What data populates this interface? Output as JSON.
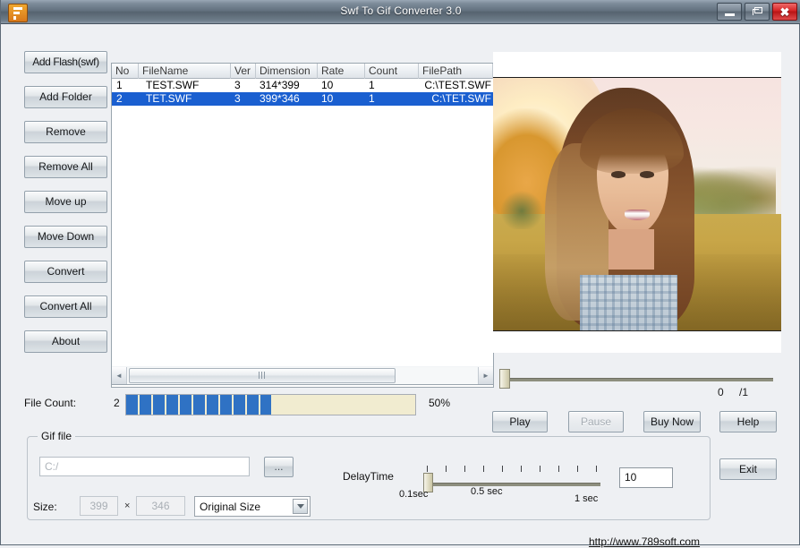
{
  "window": {
    "title": "Swf To Gif Converter 3.0",
    "app_icon": "flash-file-icon",
    "minimize_label": "minimize-icon",
    "maximize_label": "restore-icon",
    "close_label": "✖"
  },
  "sidebar": {
    "items": [
      {
        "label": "Add Flash(swf)",
        "name": "add-flash-button"
      },
      {
        "label": "Add Folder",
        "name": "add-folder-button"
      },
      {
        "label": "Remove",
        "name": "remove-button"
      },
      {
        "label": "Remove All",
        "name": "remove-all-button"
      },
      {
        "label": "Move up",
        "name": "move-up-button"
      },
      {
        "label": "Move Down",
        "name": "move-down-button"
      },
      {
        "label": "Convert",
        "name": "convert-button"
      },
      {
        "label": "Convert All",
        "name": "convert-all-button"
      },
      {
        "label": "About",
        "name": "about-button"
      }
    ]
  },
  "file_list": {
    "columns": [
      "No",
      "FileName",
      "Ver",
      "Dimension",
      "Rate",
      "Count",
      "FilePath"
    ],
    "rows": [
      {
        "no": "1",
        "filename": "TEST.SWF",
        "ver": "3",
        "dimension": "314*399",
        "rate": "10",
        "count": "1",
        "filepath": "C:\\TEST.SWF",
        "selected": false
      },
      {
        "no": "2",
        "filename": "TET.SWF",
        "ver": "3",
        "dimension": "399*346",
        "rate": "10",
        "count": "1",
        "filepath": "C:\\TET.SWF",
        "selected": true
      }
    ],
    "scroll_left_icon": "◄",
    "scroll_right_icon": "►"
  },
  "preview": {
    "name": "swf-preview-panel",
    "frame_current": "0",
    "frame_total": "/1"
  },
  "progress": {
    "file_count_label": "File Count:",
    "file_count_value": "2",
    "percent_label": "50%",
    "percent_value": 50,
    "fill_color": "#2f72c4",
    "track_color": "#f1ecd0"
  },
  "actions": {
    "play": "Play",
    "pause": "Pause",
    "buy_now": "Buy Now",
    "help": "Help",
    "exit": "Exit"
  },
  "gif_file": {
    "group_title": "Gif file",
    "path_placeholder": "C:/",
    "path_value": "",
    "browse_label": "...",
    "size_label": "Size:",
    "width": "399",
    "separator": "×",
    "height": "346",
    "size_mode": "Original Size",
    "size_mode_options": [
      "Original Size"
    ]
  },
  "delay": {
    "label": "DelayTime",
    "min_label": "0.1sec",
    "mid_label": "0.5 sec",
    "max_label": "1 sec",
    "value": "10"
  },
  "footer": {
    "url": "http://www.789soft.com"
  }
}
